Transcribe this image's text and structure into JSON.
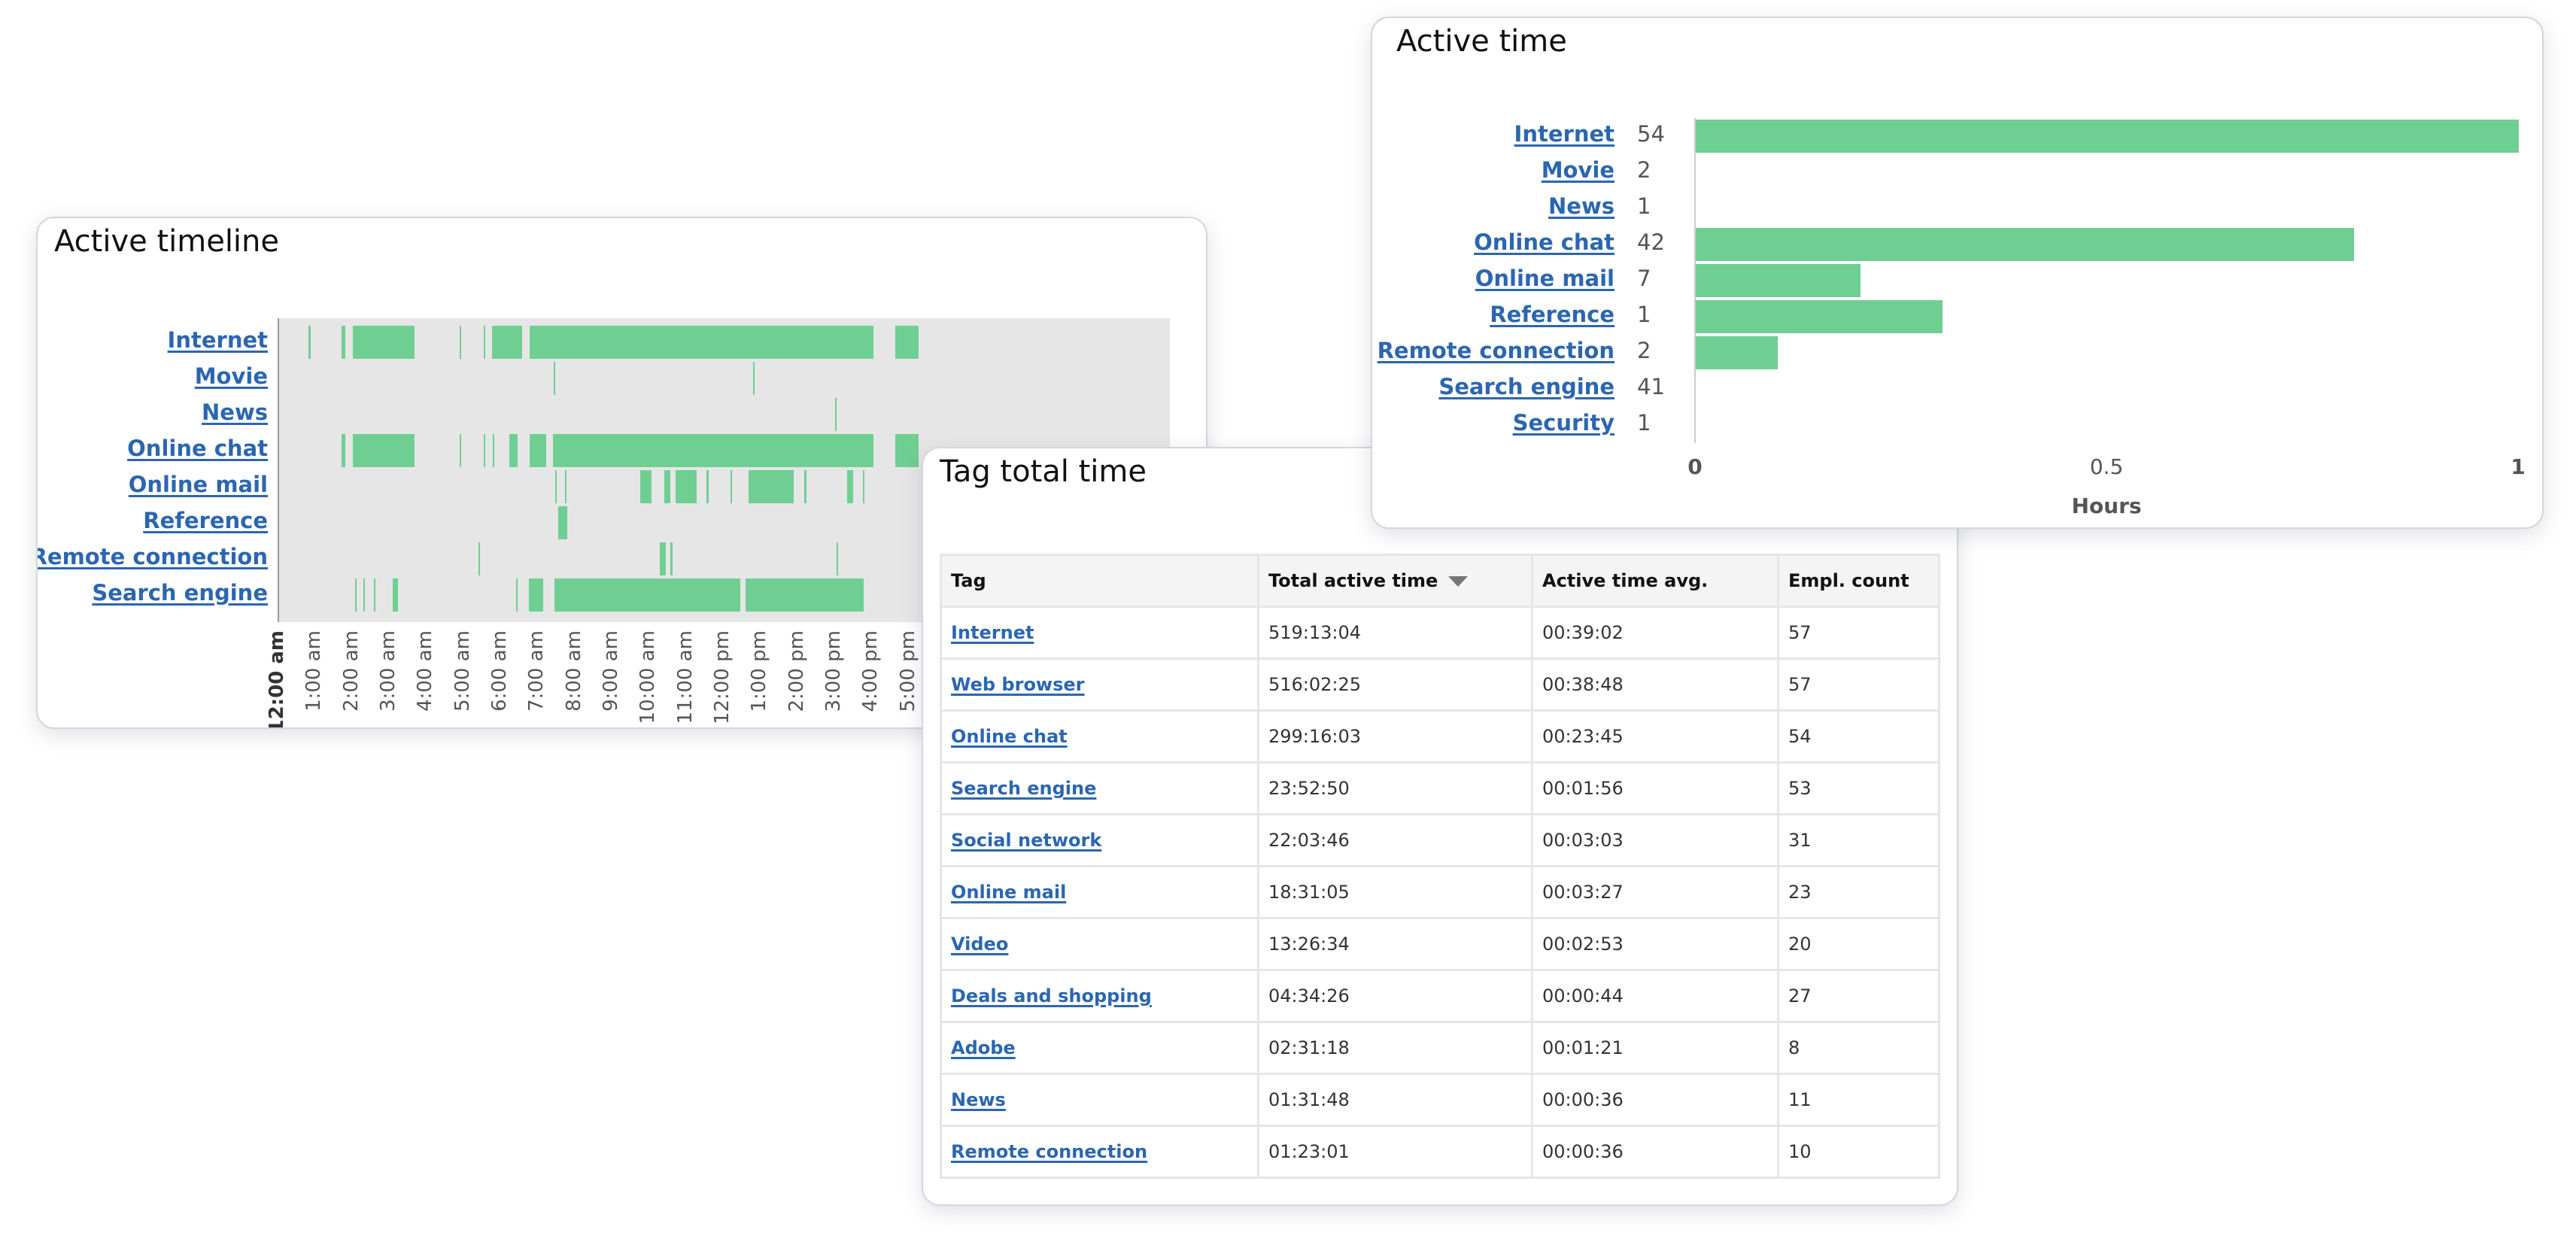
{
  "timeline": {
    "title": "Active timeline",
    "chart_data": {
      "type": "timeline",
      "x_unit": "hour of day",
      "xlim": [
        0,
        24
      ],
      "tick_labels": [
        "12:00 am",
        "1:00 am",
        "2:00 am",
        "3:00 am",
        "4:00 am",
        "5:00 am",
        "6:00 am",
        "7:00 am",
        "8:00 am",
        "9:00 am",
        "10:00 am",
        "11:00 am",
        "12:00 pm",
        "1:00 pm",
        "2:00 pm",
        "3:00 pm",
        "4:00 pm",
        "5:00 pm"
      ],
      "bar_color": "#6fcf93",
      "rows": [
        {
          "label": "Internet",
          "segments": [
            [
              0.8,
              0.85
            ],
            [
              1.68,
              1.78
            ],
            [
              1.98,
              3.64
            ],
            [
              4.86,
              4.9
            ],
            [
              5.52,
              5.56
            ],
            [
              5.73,
              6.55
            ],
            [
              6.76,
              16.02
            ],
            [
              16.6,
              17.22
            ]
          ]
        },
        {
          "label": "Movie",
          "segments": [
            [
              7.4,
              7.43
            ],
            [
              12.77,
              12.8
            ]
          ]
        },
        {
          "label": "News",
          "segments": [
            [
              14.98,
              15.01
            ]
          ]
        },
        {
          "label": "Online chat",
          "segments": [
            [
              1.68,
              1.78
            ],
            [
              1.98,
              3.64
            ],
            [
              4.86,
              4.9
            ],
            [
              5.52,
              5.56
            ],
            [
              5.76,
              5.8
            ],
            [
              6.21,
              6.42
            ],
            [
              6.76,
              7.2
            ],
            [
              7.37,
              16.02
            ],
            [
              16.6,
              17.22
            ]
          ]
        },
        {
          "label": "Online mail",
          "segments": [
            [
              7.44,
              7.47
            ],
            [
              7.7,
              7.74
            ],
            [
              9.73,
              10.04
            ],
            [
              10.38,
              10.55
            ],
            [
              10.69,
              11.26
            ],
            [
              11.52,
              11.57
            ],
            [
              12.17,
              12.21
            ],
            [
              12.65,
              13.87
            ],
            [
              14.15,
              14.2
            ],
            [
              15.3,
              15.47
            ],
            [
              15.73,
              15.77
            ]
          ]
        },
        {
          "label": "Reference",
          "segments": [
            [
              7.52,
              7.77
            ]
          ]
        },
        {
          "label": "Remote connection",
          "segments": [
            [
              5.38,
              5.41
            ],
            [
              10.25,
              10.42
            ],
            [
              10.55,
              10.6
            ],
            [
              15.02,
              15.05
            ]
          ]
        },
        {
          "label": "Search engine",
          "segments": [
            [
              2.04,
              2.08
            ],
            [
              2.27,
              2.31
            ],
            [
              2.55,
              2.59
            ],
            [
              3.07,
              3.2
            ],
            [
              6.39,
              6.42
            ],
            [
              6.72,
              7.12
            ],
            [
              7.41,
              12.42
            ],
            [
              12.57,
              15.75
            ]
          ]
        }
      ]
    }
  },
  "active_time": {
    "title": "Active time",
    "chart_data": {
      "type": "bar",
      "orientation": "horizontal",
      "xlabel": "Hours",
      "xlim": [
        0,
        1
      ],
      "x_ticks": [
        "0",
        "0.5",
        "1"
      ],
      "bar_color": "#6fcf93",
      "categories": [
        "Internet",
        "Movie",
        "News",
        "Online chat",
        "Online mail",
        "Reference",
        "Remote connection",
        "Search engine",
        "Security"
      ],
      "counts": [
        "54",
        "2",
        "1",
        "42",
        "7",
        "1",
        "2",
        "41",
        "1"
      ],
      "values": [
        1.0,
        0,
        0,
        0.8,
        0.2,
        0.3,
        0.1,
        0,
        0
      ]
    }
  },
  "tag_table": {
    "title": "Tag total time",
    "columns": [
      "Tag",
      "Total active time",
      "Active time avg.",
      "Empl. count"
    ],
    "sort_column": "Total active time",
    "sort_direction": "descending",
    "rows": [
      [
        "Internet",
        "519:13:04",
        "00:39:02",
        "57"
      ],
      [
        "Web browser",
        "516:02:25",
        "00:38:48",
        "57"
      ],
      [
        "Online chat",
        "299:16:03",
        "00:23:45",
        "54"
      ],
      [
        "Search engine",
        "23:52:50",
        "00:01:56",
        "53"
      ],
      [
        "Social network",
        "22:03:46",
        "00:03:03",
        "31"
      ],
      [
        "Online mail",
        "18:31:05",
        "00:03:27",
        "23"
      ],
      [
        "Video",
        "13:26:34",
        "00:02:53",
        "20"
      ],
      [
        "Deals and shopping",
        "04:34:26",
        "00:00:44",
        "27"
      ],
      [
        "Adobe",
        "02:31:18",
        "00:01:21",
        "8"
      ],
      [
        "News",
        "01:31:48",
        "00:00:36",
        "11"
      ],
      [
        "Remote connection",
        "01:23:01",
        "00:00:36",
        "10"
      ]
    ]
  }
}
